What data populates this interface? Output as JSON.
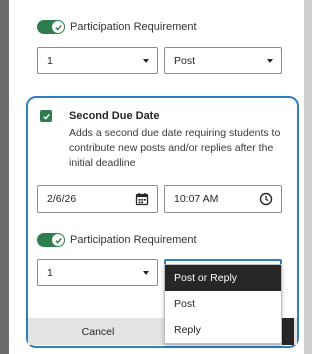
{
  "participation_top": {
    "label": "Participation Requirement",
    "count_value": "1",
    "type_value": "Post"
  },
  "second_due_date": {
    "title": "Second Due Date",
    "description": "Adds a second due date requiring students to contribute new posts and/or replies after the initial deadline",
    "date_value": "2/6/26",
    "time_value": "10:07 AM"
  },
  "participation_bottom": {
    "label": "Participation Requirement",
    "count_value": "1",
    "dropdown_options": [
      "Post or Reply",
      "Post",
      "Reply"
    ],
    "selected_option": "Post or Reply"
  },
  "footer": {
    "cancel_label": "Cancel"
  },
  "colors": {
    "accent_green": "#2e7d4f",
    "focus_blue": "#2f7fc4",
    "dark": "#262626"
  },
  "icons": [
    "check-icon",
    "calendar-icon",
    "clock-icon",
    "chevron-down-icon"
  ]
}
